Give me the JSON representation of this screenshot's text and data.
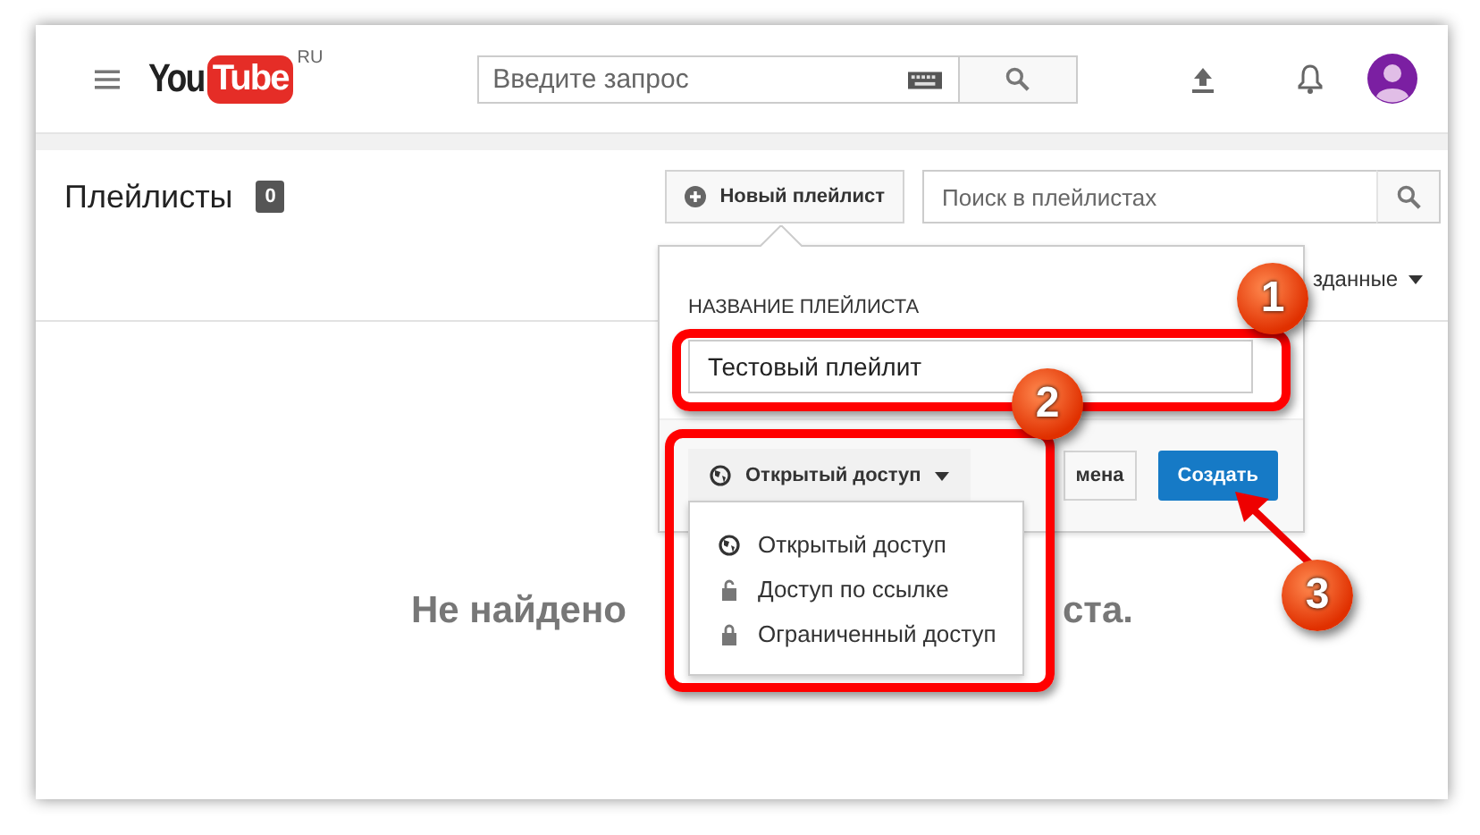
{
  "header": {
    "logo_text": "You",
    "logo_box": "Tube",
    "region": "RU",
    "search": {
      "placeholder": "Введите запрос"
    }
  },
  "page": {
    "title": "Плейлисты",
    "count": "0",
    "new_playlist_button": "Новый плейлист",
    "search": {
      "placeholder": "Поиск в плейлистах"
    },
    "sort_label": "зданные",
    "empty_message_parts": [
      "Не найдено",
      "ста."
    ]
  },
  "dialog": {
    "name_label": "НАЗВАНИЕ ПЛЕЙЛИСТА",
    "name_value": "Тестовый плейлит",
    "privacy": {
      "label": "Открытый доступ",
      "kind": "public",
      "expanded": true
    },
    "cancel_button": "мена",
    "create_button": "Создать"
  },
  "privacy_menu": [
    {
      "label": "Открытый доступ",
      "kind": "public"
    },
    {
      "label": "Доступ по ссылке",
      "kind": "unlisted"
    },
    {
      "label": "Ограниченный доступ",
      "kind": "private"
    }
  ],
  "callouts": [
    {
      "label": "1"
    },
    {
      "label": "2"
    },
    {
      "label": "3"
    }
  ]
}
